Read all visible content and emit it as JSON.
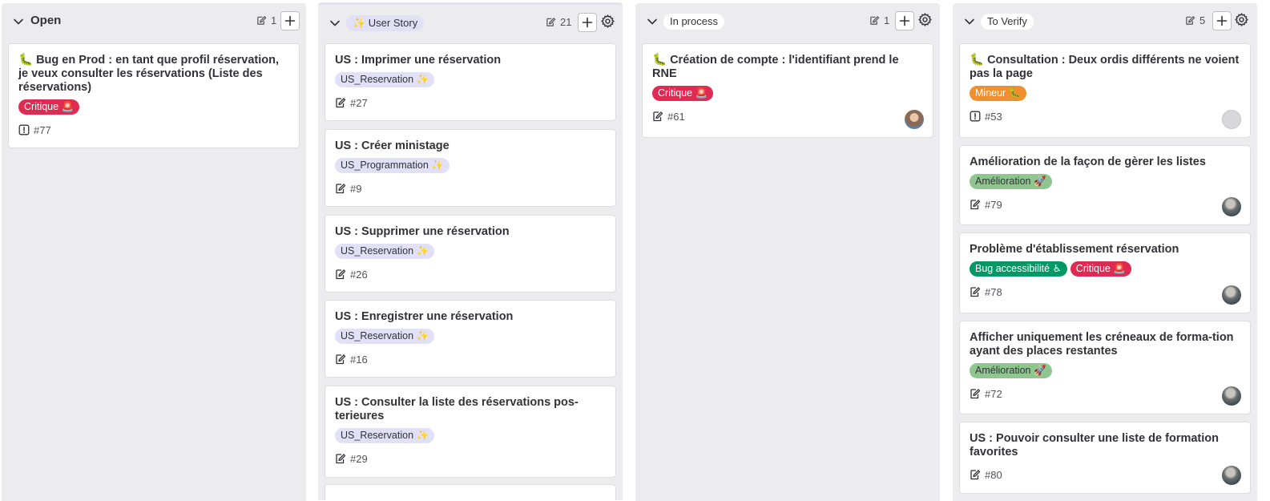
{
  "lists": [
    {
      "title": "Open",
      "count": "1",
      "cards": [
        {
          "title": "🐛 Bug en Prod : en tant que profil réservation, je veux consulter les réservations (Liste des réservations)",
          "labels": [
            {
              "text": "Critique 🚨",
              "kind": "critique"
            }
          ],
          "ref": "#77",
          "type_icon": "issue-icon"
        }
      ]
    },
    {
      "title": "✨ User Story",
      "count": "21",
      "cards": [
        {
          "title": "US : Imprimer une réservation",
          "labels": [
            {
              "text": "US_Reservation ✨",
              "kind": "us"
            }
          ],
          "ref": "#27",
          "type_icon": "task-icon"
        },
        {
          "title": "US : Créer ministage",
          "labels": [
            {
              "text": "US_Programmation ✨",
              "kind": "us"
            }
          ],
          "ref": "#9",
          "type_icon": "task-icon"
        },
        {
          "title": "US : Supprimer une réservation",
          "labels": [
            {
              "text": "US_Reservation ✨",
              "kind": "us"
            }
          ],
          "ref": "#26",
          "type_icon": "task-icon"
        },
        {
          "title": "US : Enregistrer une réservation",
          "labels": [
            {
              "text": "US_Reservation ✨",
              "kind": "us"
            }
          ],
          "ref": "#16",
          "type_icon": "task-icon"
        },
        {
          "title": "US : Consulter la liste des réservations pos-terieures",
          "labels": [
            {
              "text": "US_Reservation ✨",
              "kind": "us"
            }
          ],
          "ref": "#29",
          "type_icon": "task-icon"
        }
      ]
    },
    {
      "title": "In process",
      "count": "1",
      "cards": [
        {
          "title": "🐛 Création de compte : l'identifiant prend le RNE",
          "labels": [
            {
              "text": "Critique 🚨",
              "kind": "critique"
            }
          ],
          "ref": "#61",
          "type_icon": "task-icon"
        }
      ]
    },
    {
      "title": "To Verify",
      "count": "5",
      "cards": [
        {
          "title": "🐛 Consultation : Deux ordis différents ne voient pas la page",
          "labels": [
            {
              "text": "Mineur 🐛",
              "kind": "mineur"
            }
          ],
          "ref": "#53",
          "type_icon": "issue-icon"
        },
        {
          "title": "Amélioration de la façon de gèrer les listes",
          "labels": [
            {
              "text": "Amélioration 🚀",
              "kind": "amelio"
            }
          ],
          "ref": "#79",
          "type_icon": "task-icon"
        },
        {
          "title": "Problème d'établissement réservation",
          "labels": [
            {
              "text": "Bug accessibilité ♿",
              "kind": "bugacc"
            },
            {
              "text": "Critique 🚨",
              "kind": "critique"
            }
          ],
          "ref": "#78",
          "type_icon": "task-icon"
        },
        {
          "title": "Afficher uniquement les créneaux de forma-tion ayant des places restantes",
          "labels": [
            {
              "text": "Amélioration 🚀",
              "kind": "amelio"
            }
          ],
          "ref": "#72",
          "type_icon": "task-icon"
        },
        {
          "title": "US : Pouvoir consulter une liste de formation favorites",
          "labels": [],
          "ref": "#80",
          "type_icon": "task-icon"
        }
      ]
    }
  ],
  "colors": {
    "list_bg": "#ececef",
    "critique": "#dd2b52",
    "mineur": "#ef8f2f",
    "amelioration": "#8fc58e",
    "bug_accessibilite": "#009966",
    "us_label": "#e1e0f7"
  }
}
